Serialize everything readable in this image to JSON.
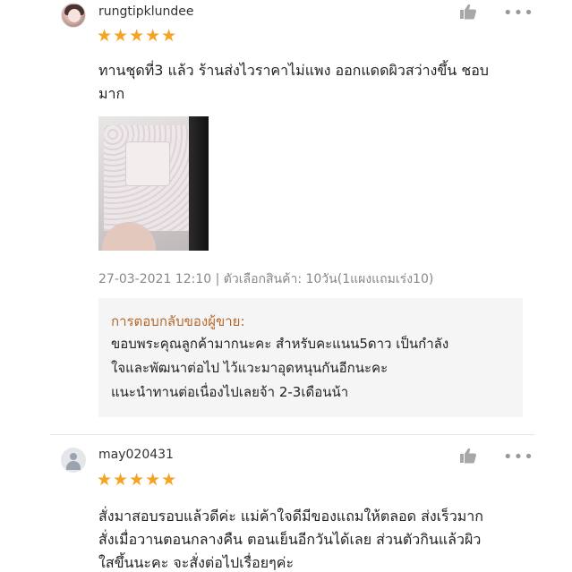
{
  "reviews": [
    {
      "username": "rungtipklundee",
      "stars": "★★★★★",
      "rating": 5,
      "comment_lines": [
        "ทานชุดที่3 แล้ว ร้านส่งไวราคาไม่แพง ออกแดดผิวสว่างขึ้น ชอบ",
        "มาก"
      ],
      "meta": "27-03-2021 12:10 | ตัวเลือกสินค้า: 10วัน(1แผงแถมเร่ง10)",
      "seller_reply": {
        "title": "การตอบกลับของผู้ขาย:",
        "lines": [
          "ขอบพระคุณลูกค้ามากนะคะ สำหรับคะแนน5ดาว เป็นกำลัง",
          "ใจและพัฒนาต่อไป ไว้แวะมาอุดหนุนกันอีกนะคะ",
          "แนะนำทานต่อเนื่องไปเลยจ้า 2-3เดือนน้า"
        ]
      }
    },
    {
      "username": "may020431",
      "stars": "★★★★★",
      "rating": 5,
      "comment_lines": [
        "สั่งมาสอบรอบแล้วดีค่ะ แม่ค้าใจดีมีของแถมให้ตลอด ส่งเร็วมาก",
        "สั่งเมื่อวานตอนกลางคืน ตอนเย็นอีกวันได้เลย ส่วนตัวกินแล้วผิว",
        "ใสขึ้นนะคะ จะสั่งต่อไปเรื่อยๆค่ะ"
      ]
    }
  ],
  "icons": {
    "like": "thumbs-up-icon",
    "more": "more-options-icon",
    "more_glyph": "•••"
  },
  "colors": {
    "star": "#f6a323",
    "seller_title": "#b3692e",
    "meta": "#888888",
    "reply_bg": "#f5f5f5"
  }
}
